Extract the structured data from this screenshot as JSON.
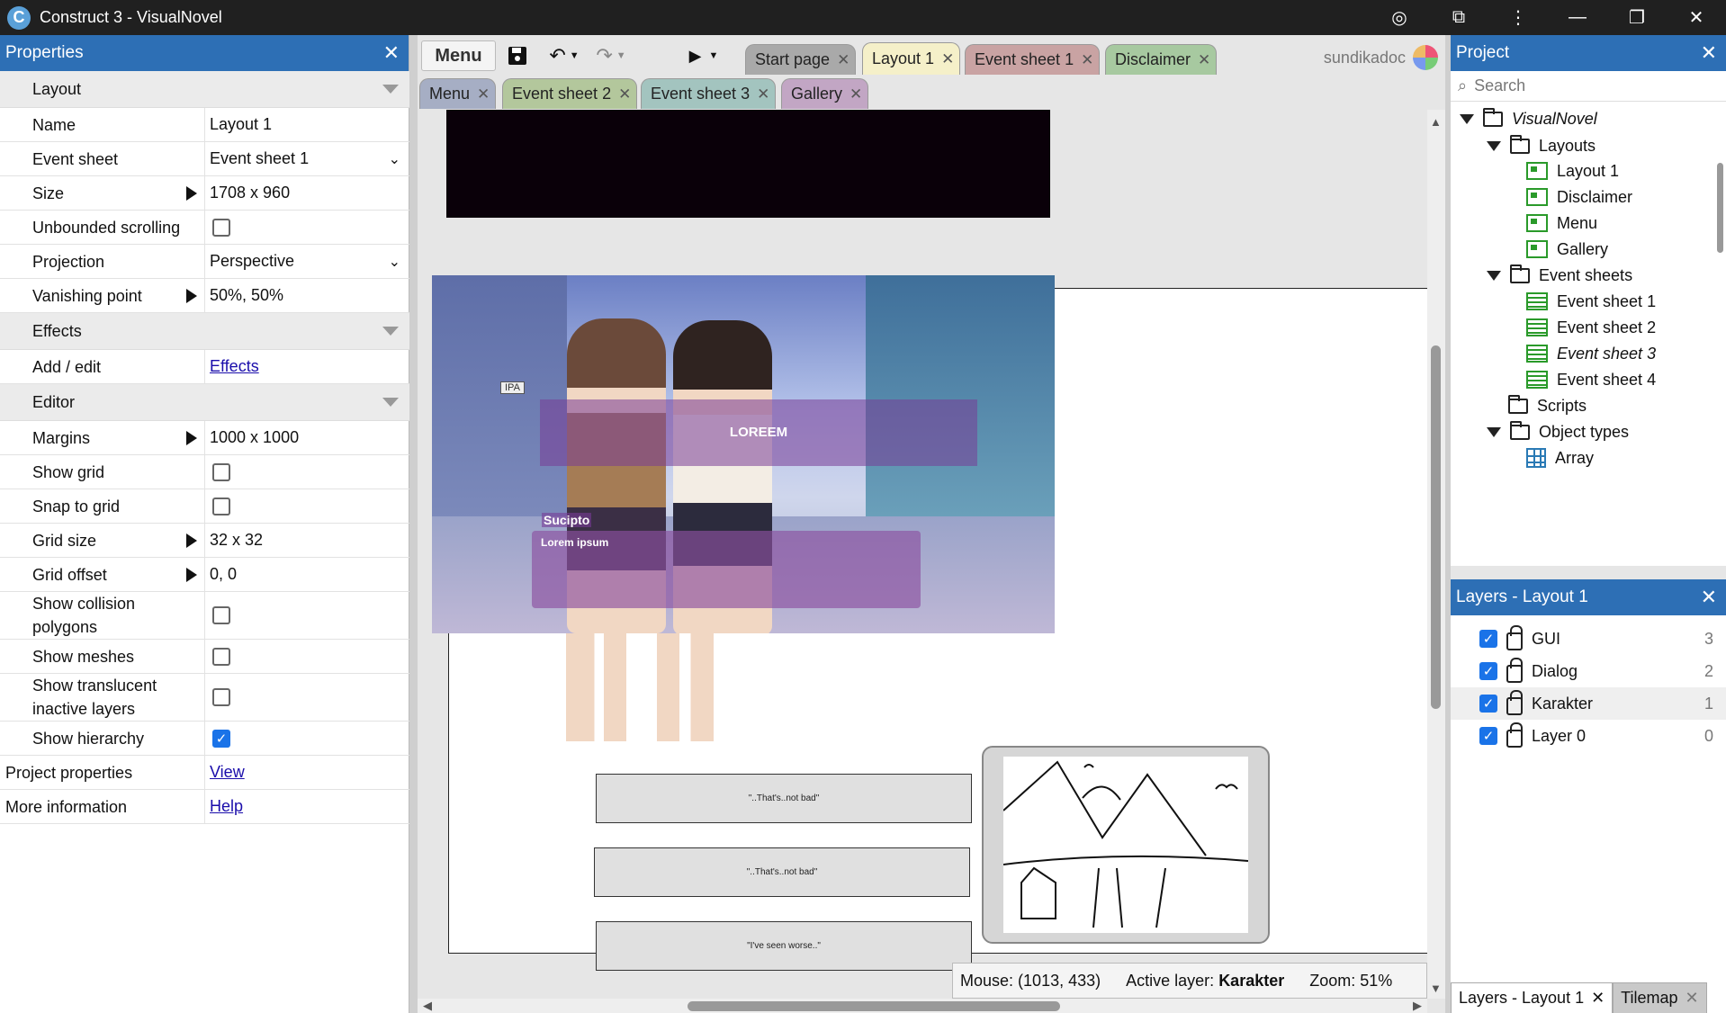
{
  "window": {
    "title": "Construct 3 - VisualNovel",
    "logo_glyph": "C"
  },
  "properties": {
    "title": "Properties",
    "sections": {
      "layout": "Layout",
      "effects": "Effects",
      "editor": "Editor"
    },
    "rows": {
      "name": {
        "label": "Name",
        "value": "Layout 1"
      },
      "event_sheet": {
        "label": "Event sheet",
        "value": "Event sheet 1"
      },
      "size": {
        "label": "Size",
        "value": "1708 x 960"
      },
      "unbounded": {
        "label": "Unbounded scrolling",
        "checked": false
      },
      "projection": {
        "label": "Projection",
        "value": "Perspective"
      },
      "vanishing": {
        "label": "Vanishing point",
        "value": "50%, 50%"
      },
      "add_edit": {
        "label": "Add / edit",
        "link": "Effects"
      },
      "margins": {
        "label": "Margins",
        "value": "1000 x 1000"
      },
      "show_grid": {
        "label": "Show grid",
        "checked": false
      },
      "snap_grid": {
        "label": "Snap to grid",
        "checked": false
      },
      "grid_size": {
        "label": "Grid size",
        "value": "32 x 32"
      },
      "grid_offset": {
        "label": "Grid offset",
        "value": "0, 0"
      },
      "collision": {
        "label": "Show collision polygons",
        "checked": false
      },
      "meshes": {
        "label": "Show meshes",
        "checked": false
      },
      "translucent": {
        "label": "Show translucent inactive layers",
        "checked": false
      },
      "hierarchy": {
        "label": "Show hierarchy",
        "checked": true
      },
      "project_props": {
        "label": "Project properties",
        "link": "View"
      },
      "more_info": {
        "label": "More information",
        "link": "Help"
      }
    }
  },
  "toolbar": {
    "menu_label": "Menu",
    "user_name": "sundikadoc"
  },
  "tabs_row1": [
    {
      "label": "Start page",
      "color": "#a9a9a9"
    },
    {
      "label": "Layout 1",
      "color": "#f5f0c9"
    },
    {
      "label": "Event sheet 1",
      "color": "#c9a3a3"
    },
    {
      "label": "Disclaimer",
      "color": "#a7c9a0"
    }
  ],
  "tabs_row2": [
    {
      "label": "Menu",
      "color": "#a6aec4"
    },
    {
      "label": "Event sheet 2",
      "color": "#b3c79c"
    },
    {
      "label": "Event sheet 3",
      "color": "#a3c4bf"
    },
    {
      "label": "Gallery",
      "color": "#c2a6c4"
    }
  ],
  "scene": {
    "ipa_sign": "IPA",
    "dialog_title": "LOREEM",
    "speaker_name": "Sucipto",
    "dialog_text": "Lorem ipsum",
    "choices": [
      "\"..That's..not bad\"",
      "\"..That's..not bad\"",
      "\"I've seen worse..\""
    ]
  },
  "status": {
    "mouse_label": "Mouse:",
    "mouse_value": "(1013, 433)",
    "layer_label": "Active layer:",
    "layer_value": "Karakter",
    "zoom_label": "Zoom:",
    "zoom_value": "51%"
  },
  "project": {
    "title": "Project",
    "search_placeholder": "Search",
    "root": "VisualNovel",
    "layouts_folder": "Layouts",
    "layouts": [
      "Layout 1",
      "Disclaimer",
      "Menu",
      "Gallery"
    ],
    "event_sheets_folder": "Event sheets",
    "event_sheets": [
      "Event sheet 1",
      "Event sheet 2",
      "Event sheet 3",
      "Event sheet 4"
    ],
    "scripts_folder": "Scripts",
    "object_types_folder": "Object types",
    "object_types": [
      "Array"
    ]
  },
  "layers": {
    "title": "Layers - Layout 1",
    "items": [
      {
        "name": "GUI",
        "index": "3"
      },
      {
        "name": "Dialog",
        "index": "2"
      },
      {
        "name": "Karakter",
        "index": "1"
      },
      {
        "name": "Layer 0",
        "index": "0"
      }
    ]
  },
  "bottom_tabs": [
    "Layers - Layout 1",
    "Tilemap"
  ]
}
